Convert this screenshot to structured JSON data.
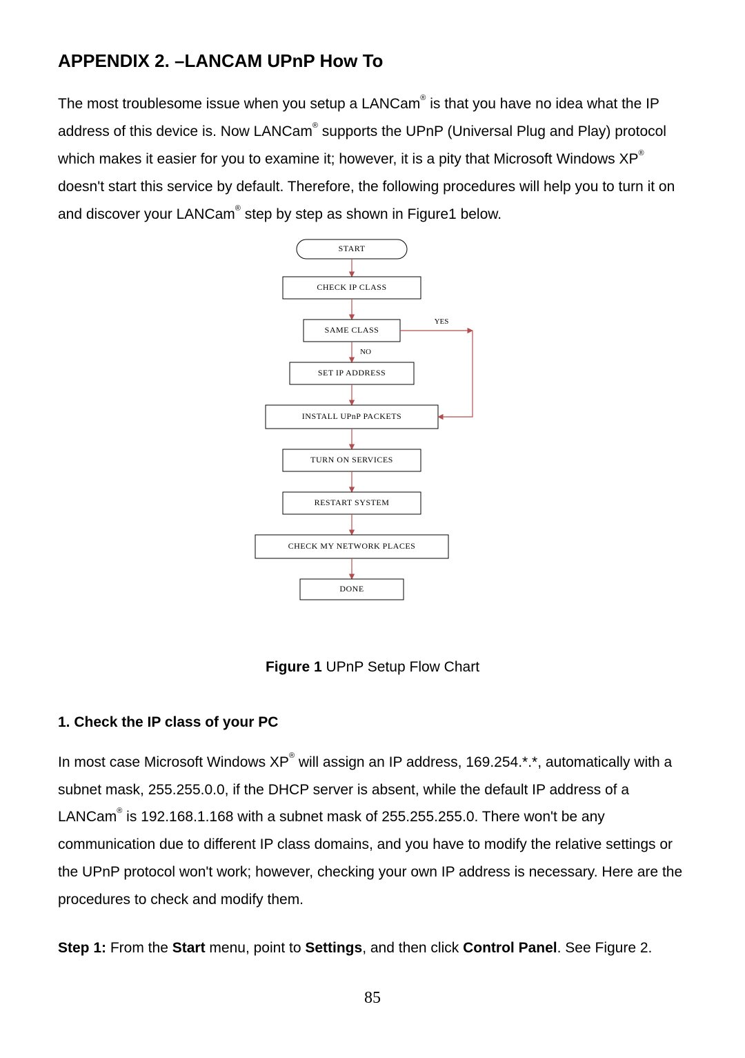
{
  "title": "APPENDIX 2. –LANCAM UPnP How To",
  "intro": {
    "p1a": "The most troublesome issue when you setup a LANCam",
    "p1b": " is that you have no idea what the IP address of this device is. Now LANCam",
    "p1c": " supports the UPnP (Universal Plug and Play) protocol which makes it easier for you to examine it; however, it is a pity that Microsoft Windows XP",
    "p1d": " doesn't start this service by default. Therefore, the following procedures will help you to turn it on and discover your LANCam",
    "p1e": " step by step as shown in Figure1 below."
  },
  "reg": "®",
  "flow": {
    "start": "START",
    "check_ip": "CHECK IP CLASS",
    "same_class": "SAME CLASS",
    "yes": "YES",
    "no": "NO",
    "set_ip": "SET IP ADDRESS",
    "install": "INSTALL UPnP PACKETS",
    "turn_on": "TURN ON SERVICES",
    "restart": "RESTART SYSTEM",
    "check_net": "CHECK MY NETWORK PLACES",
    "done": "DONE"
  },
  "caption_bold": "Figure 1",
  "caption_rest": " UPnP Setup Flow Chart",
  "section1_head": "1. Check the IP class of your PC",
  "section1": {
    "a": "In most case Microsoft Windows XP",
    "b": " will assign an IP address, 169.254.*.*, automatically with a subnet mask, 255.255.0.0, if the DHCP server is absent, while the default IP address of a LANCam",
    "c": " is 192.168.1.168 with a subnet mask of 255.255.255.0. There won't be any communication due to different IP class domains, and you have to modify the relative settings or the UPnP protocol won't work; however, checking your own IP address is necessary. Here are the procedures to check and modify them."
  },
  "step1": {
    "label": "Step 1:",
    "a": " From the ",
    "b": "Start",
    "c": " menu, point to ",
    "d": "Settings",
    "e": ", and then click ",
    "f": "Control Panel",
    "g": ". See Figure 2."
  },
  "page": "85"
}
